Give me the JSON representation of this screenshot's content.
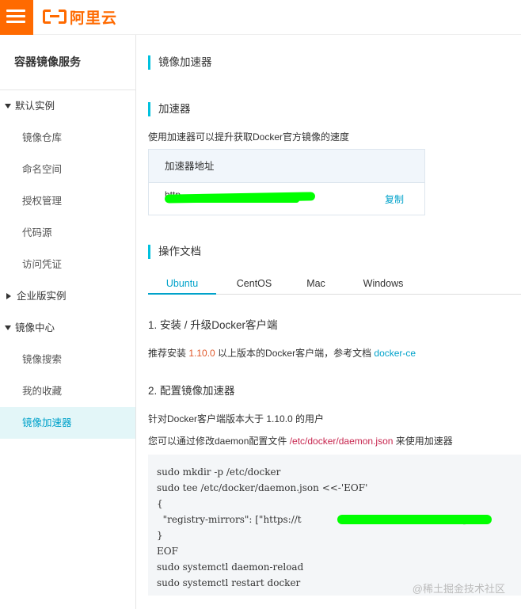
{
  "brand": {
    "logo_text": "阿里云",
    "accent": "#ff6a00"
  },
  "sidebar": {
    "title": "容器镜像服务",
    "groups": [
      {
        "label": "默认实例",
        "expanded": true,
        "items": [
          "镜像仓库",
          "命名空间",
          "授权管理",
          "代码源",
          "访问凭证"
        ]
      },
      {
        "label": "企业版实例",
        "expanded": false,
        "items": []
      },
      {
        "label": "镜像中心",
        "expanded": true,
        "items": [
          "镜像搜索",
          "我的收藏",
          "镜像加速器"
        ]
      }
    ],
    "active_item": "镜像加速器"
  },
  "main": {
    "page_title": "镜像加速器",
    "accelerator": {
      "section_title": "加速器",
      "description": "使用加速器可以提升获取Docker官方镜像的速度",
      "table_header": "加速器地址",
      "url_prefix": "http",
      "copy_label": "复制"
    },
    "docs": {
      "section_title": "操作文档",
      "tabs": [
        "Ubuntu",
        "CentOS",
        "Mac",
        "Windows"
      ],
      "active_tab": "Ubuntu",
      "step1": {
        "title": "1. 安装 / 升级Docker客户端",
        "text_before": "推荐安装 ",
        "version": "1.10.0",
        "text_after": " 以上版本的Docker客户端，参考文档 ",
        "link": "docker-ce"
      },
      "step2": {
        "title": "2. 配置镜像加速器",
        "line1": "针对Docker客户端版本大于 1.10.0 的用户",
        "line2_before": "您可以通过修改daemon配置文件 ",
        "line2_path": "/etc/docker/daemon.json",
        "line2_after": " 来使用加速器"
      },
      "code_lines": [
        "sudo mkdir -p /etc/docker",
        "sudo tee /etc/docker/daemon.json <<-'EOF'",
        "{",
        "  \"registry-mirrors\": [\"https://t",
        "}",
        "EOF",
        "sudo systemctl daemon-reload",
        "sudo systemctl restart docker"
      ],
      "code_line4_suffix": "\"]"
    }
  },
  "watermark": "@稀土掘金技术社区"
}
